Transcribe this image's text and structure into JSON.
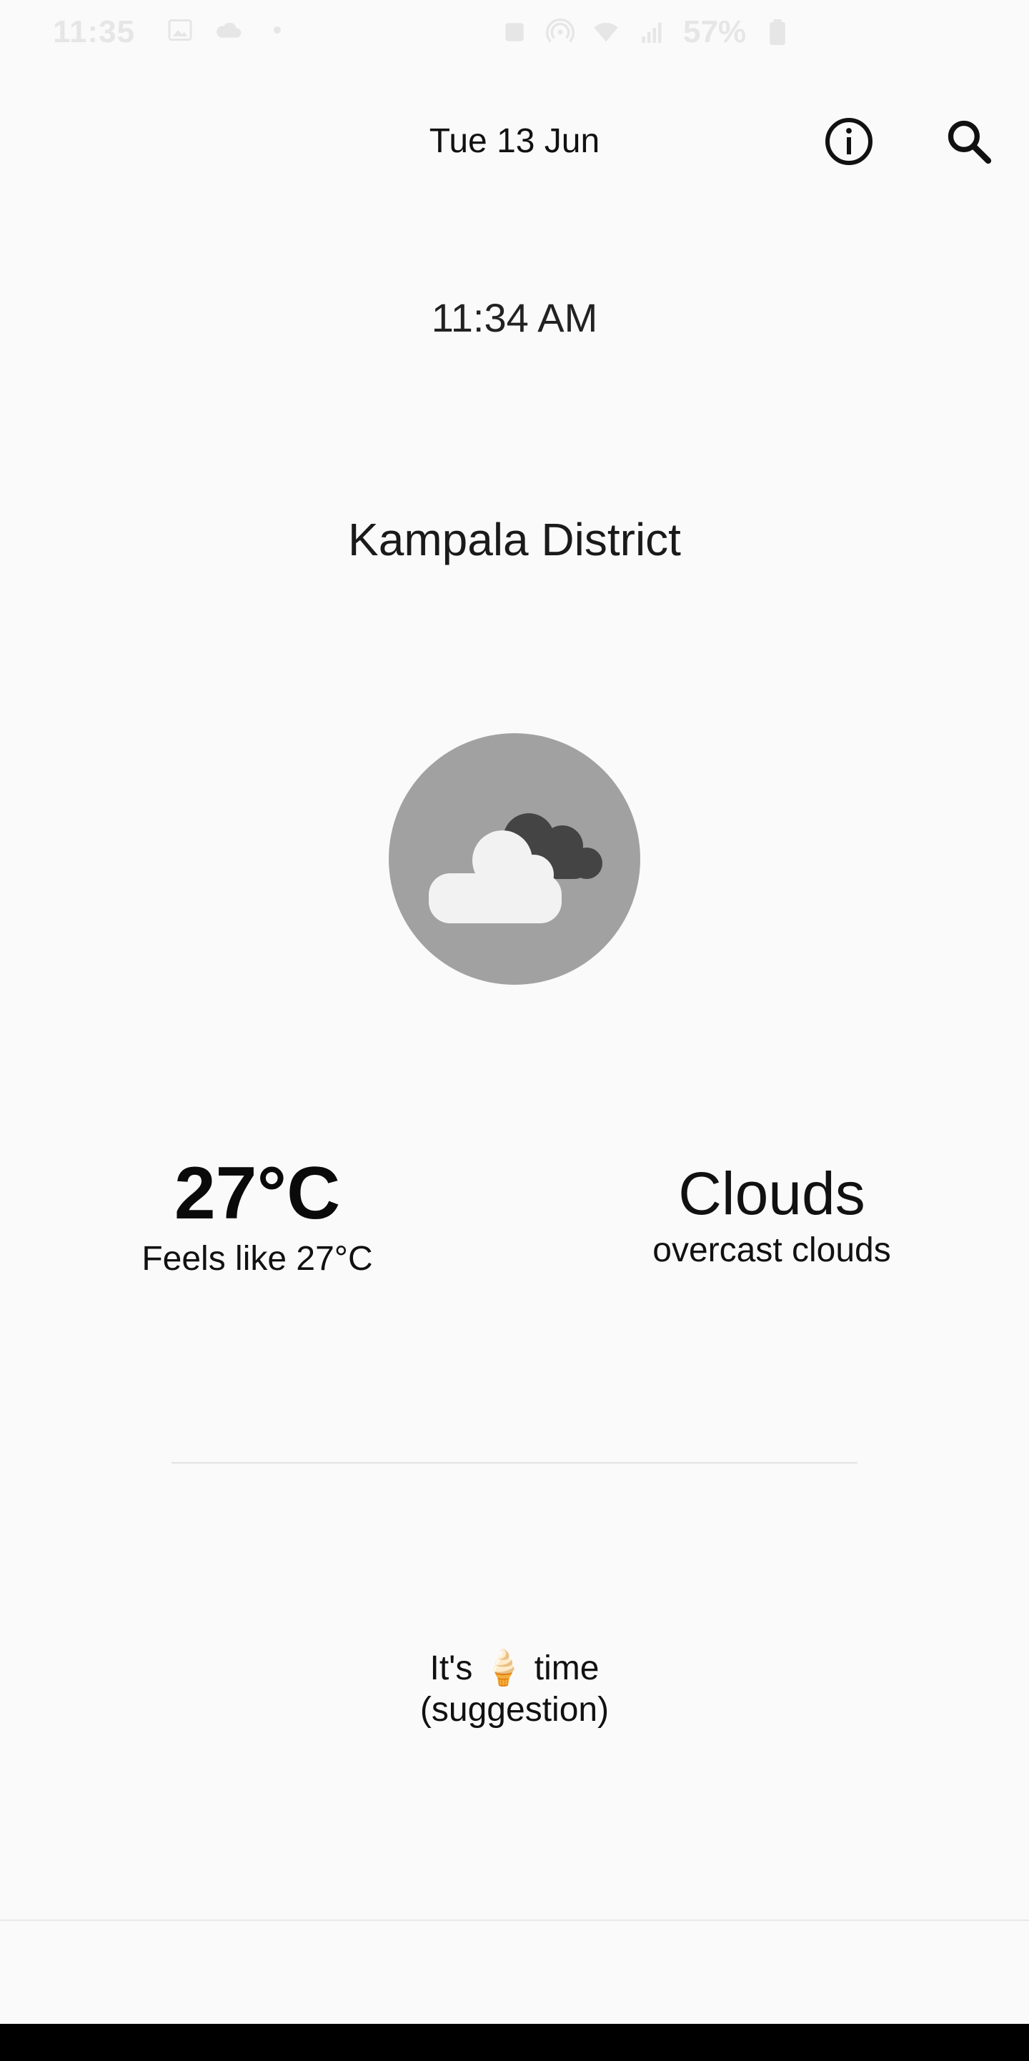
{
  "status_bar": {
    "time": "11:35",
    "battery_percent": "57%"
  },
  "header": {
    "date": "Tue 13 Jun",
    "info_icon": "info-icon",
    "search_icon": "search-icon"
  },
  "clock": {
    "time": "11:34 AM"
  },
  "location": {
    "name": "Kampala District"
  },
  "weather": {
    "icon": "cloud-icon",
    "temperature": "27°C",
    "feels_like": "Feels like 27°C",
    "condition": "Clouds",
    "description": "overcast clouds"
  },
  "suggestion": {
    "line1_prefix": "It's",
    "emoji": "🍦",
    "line1_suffix": "time",
    "line2": "(suggestion)"
  },
  "colors": {
    "background": "#fafafa",
    "circle": "#a1a1a1",
    "cloud_front": "#f2f2f2",
    "cloud_back": "#444444"
  }
}
